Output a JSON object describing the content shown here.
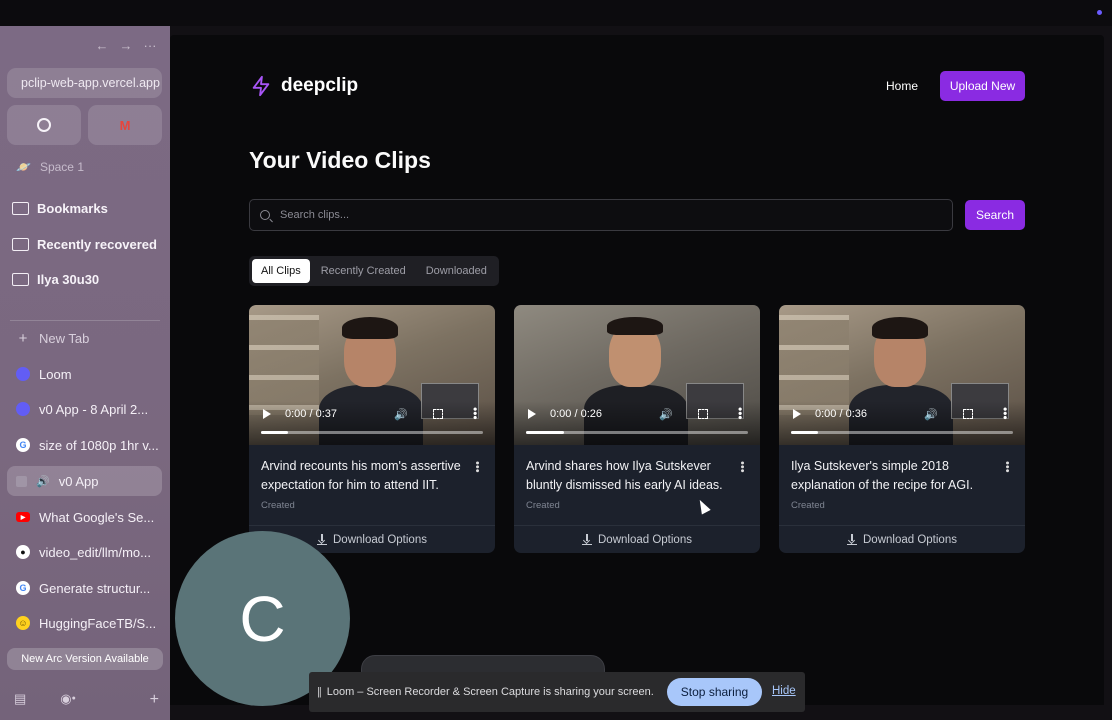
{
  "browser": {
    "url": "pclip-web-app.vercel.app",
    "nav": {
      "back": "←",
      "forward": "→",
      "menu": "···"
    },
    "space_label": "Space 1",
    "folders": [
      {
        "label": "Bookmarks"
      },
      {
        "label": "Recently recovered"
      },
      {
        "label": "Ilya 30u30"
      }
    ],
    "new_tab_label": "New Tab",
    "tabs": [
      {
        "label": "Loom",
        "icon": "loom-icon"
      },
      {
        "label": "v0 App - 8 April 2...",
        "icon": "v0-icon"
      },
      {
        "label": "size of 1080p 1hr v...",
        "icon": "google-icon"
      },
      {
        "label": "v0 App",
        "icon": "speaker-icon",
        "active": true
      },
      {
        "label": "What Google's Se...",
        "icon": "youtube-icon"
      },
      {
        "label": "video_edit/llm/mo...",
        "icon": "github-icon"
      },
      {
        "label": "Generate structur...",
        "icon": "google-icon"
      },
      {
        "label": "HuggingFaceTB/S...",
        "icon": "huggingface-icon"
      }
    ],
    "update_label": "New Arc Version Available"
  },
  "app": {
    "brand": "deepclip",
    "nav_home": "Home",
    "upload_label": "Upload New",
    "page_title": "Your Video Clips",
    "search_placeholder": "Search clips...",
    "search_button": "Search",
    "filter_tabs": [
      "All Clips",
      "Recently Created",
      "Downloaded"
    ],
    "active_filter": "All Clips",
    "clips": [
      {
        "time": "0:00 / 0:37",
        "title": "Arvind recounts his mom's assertive expectation for him to attend IIT.",
        "meta": "Created",
        "download_label": "Download Options"
      },
      {
        "time": "0:00 / 0:26",
        "title": "Arvind shares how Ilya Sutskever bluntly dismissed his early AI ideas.",
        "meta": "Created",
        "download_label": "Download Options"
      },
      {
        "time": "0:00 / 0:36",
        "title": "Ilya Sutskever's simple 2018 explanation of the recipe for AGI.",
        "meta": "Created",
        "download_label": "Download Options"
      }
    ]
  },
  "loom": {
    "avatar_letter": "C",
    "share_message": "Loom – Screen Recorder & Screen Capture is sharing your screen.",
    "stop_label": "Stop sharing",
    "hide_label": "Hide"
  },
  "colors": {
    "accent": "#8a2be2",
    "card": "#1c212c",
    "sidebar": "#7a687f",
    "stop_button": "#a8c7fa"
  }
}
